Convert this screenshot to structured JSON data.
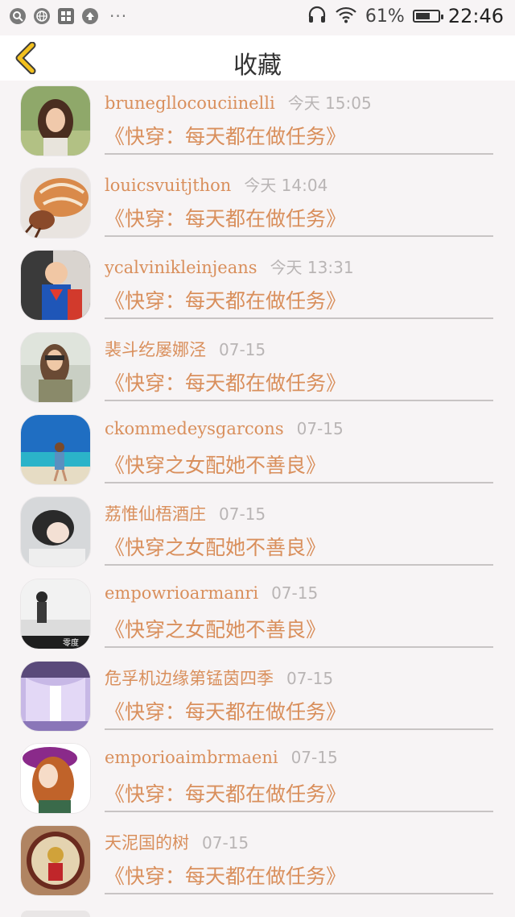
{
  "status_bar": {
    "battery_percent": "61%",
    "time": "22:46",
    "icons": [
      "search-icon",
      "globe-icon",
      "apps-icon",
      "upload-icon",
      "more-dots-icon",
      "headphones-icon",
      "wifi-icon",
      "battery-icon"
    ],
    "more": "···"
  },
  "header": {
    "title": "收藏",
    "back_icon": "chevron-left-icon",
    "accent": "#f2c01e"
  },
  "colors": {
    "accent_text": "#d98f5c",
    "time_text": "#b9b5b5",
    "divider": "#c8c4c4"
  },
  "favorites": [
    {
      "name": "brunegllocouciinelli",
      "time": "今天 15:05",
      "book": "《快穿：每天都在做任务》"
    },
    {
      "name": "louicsvuitjthon",
      "time": "今天 14:04",
      "book": "《快穿：每天都在做任务》"
    },
    {
      "name": "ycalvinikleinjeans",
      "time": "今天 13:31",
      "book": "《快穿：每天都在做任务》"
    },
    {
      "name": "裴斗纥屡娜泾",
      "time": "07-15",
      "book": "《快穿：每天都在做任务》"
    },
    {
      "name": "ckommedeysgarcons",
      "time": "07-15",
      "book": "《快穿之女配她不善良》"
    },
    {
      "name": "荔惟仙梧酒庄",
      "time": "07-15",
      "book": "《快穿之女配她不善良》"
    },
    {
      "name": "empowrioarmanri",
      "time": "07-15",
      "book": "《快穿之女配她不善良》"
    },
    {
      "name": "危孚机边缘第锰茵四季",
      "time": "07-15",
      "book": "《快穿：每天都在做任务》"
    },
    {
      "name": "emporioaimbrmaeni",
      "time": "07-15",
      "book": "《快穿：每天都在做任务》"
    },
    {
      "name": "天泥国的树",
      "time": "07-15",
      "book": "《快穿：每天都在做任务》"
    }
  ],
  "avatar_caption_7": "零度"
}
